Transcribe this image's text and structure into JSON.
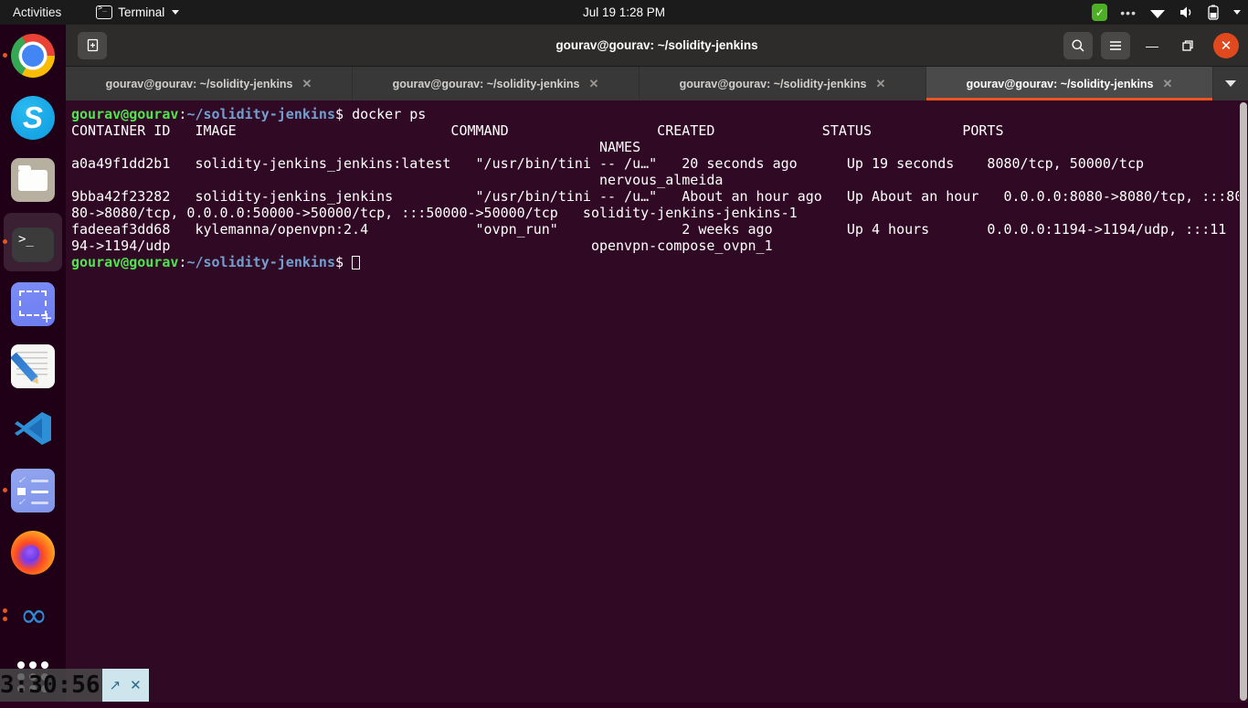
{
  "topbar": {
    "activities": "Activities",
    "app_menu": "Terminal",
    "clock": "Jul 19  1:28 PM",
    "icons": [
      "shield-check-icon",
      "ellipsis-icon",
      "wifi-icon",
      "volume-icon",
      "battery-icon",
      "chevron-down-icon"
    ]
  },
  "dock": {
    "items": [
      {
        "name": "google-chrome",
        "running": true
      },
      {
        "name": "skype",
        "running": false
      },
      {
        "name": "files",
        "running": false
      },
      {
        "name": "terminal",
        "running": true,
        "active": true
      },
      {
        "name": "screenshot-tool",
        "running": false
      },
      {
        "name": "text-editor",
        "running": false
      },
      {
        "name": "visual-studio-code",
        "running": false
      },
      {
        "name": "tasks",
        "running": true
      },
      {
        "name": "firefox",
        "running": false
      },
      {
        "name": "remmina",
        "running": true
      },
      {
        "name": "show-applications",
        "running": false
      }
    ]
  },
  "window": {
    "title": "gourav@gourav: ~/solidity-jenkins",
    "new_tab_label": "+",
    "search_icon": "search-icon",
    "menu_icon": "hamburger-menu-icon",
    "minimize_label": "—",
    "maximize_label": "❐",
    "close_label": "✕"
  },
  "tabs": [
    {
      "label": "gourav@gourav: ~/solidity-jenkins",
      "close": "✕",
      "active": false
    },
    {
      "label": "gourav@gourav: ~/solidity-jenkins",
      "close": "✕",
      "active": false
    },
    {
      "label": "gourav@gourav: ~/solidity-jenkins",
      "close": "✕",
      "active": false
    },
    {
      "label": "gourav@gourav: ~/solidity-jenkins",
      "close": "✕",
      "active": true
    }
  ],
  "terminal": {
    "prompt_user": "gourav@gourav",
    "prompt_colon": ":",
    "prompt_path": "~/solidity-jenkins",
    "prompt_sigil": "$ ",
    "command": "docker ps",
    "output_lines": [
      "CONTAINER ID   IMAGE                          COMMAND                  CREATED             STATUS           PORTS",
      "                                                                NAMES",
      "a0a49f1dd2b1   solidity-jenkins_jenkins:latest   \"/usr/bin/tini -- /u…\"   20 seconds ago      Up 19 seconds    8080/tcp, 50000/tcp",
      "                                                                nervous_almeida",
      "9bba42f23282   solidity-jenkins_jenkins          \"/usr/bin/tini -- /u…\"   About an hour ago   Up About an hour   0.0.0.0:8080->8080/tcp, :::80",
      "80->8080/tcp, 0.0.0.0:50000->50000/tcp, :::50000->50000/tcp   solidity-jenkins-jenkins-1",
      "fadeeaf3dd68   kylemanna/openvpn:2.4             \"ovpn_run\"               2 weeks ago         Up 4 hours       0.0.0.0:1194->1194/udp, :::11",
      "94->1194/udp                                                   openvpn-compose_ovpn_1"
    ],
    "cursor": "block-cursor"
  },
  "recorder": {
    "time": "3:30:56",
    "restore_icon": "↗",
    "close_icon": "✕"
  }
}
